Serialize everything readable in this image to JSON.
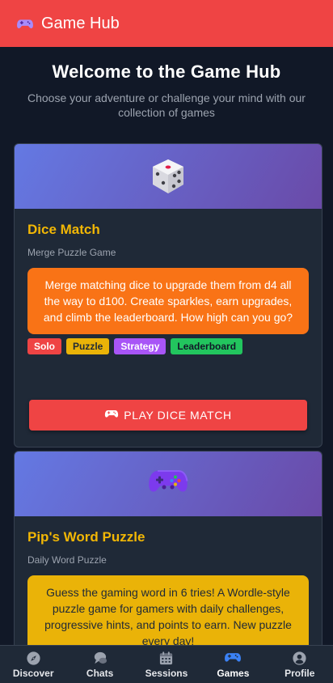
{
  "header": {
    "title": "Game Hub",
    "logo_icon": "gamepad-icon"
  },
  "hero": {
    "title": "Welcome to the Game Hub",
    "subtitle": "Choose your adventure or challenge your mind with our collection of games"
  },
  "games": [
    {
      "title": "Dice Match",
      "subtitle": "Merge Puzzle Game",
      "icon": "dice-icon",
      "description": "Merge matching dice to upgrade them from d4 all the way to d100. Create sparkles, earn upgrades, and climb the leaderboard. How high can you go?",
      "tags": [
        "Solo",
        "Puzzle",
        "Strategy",
        "Leaderboard"
      ],
      "button_label": "PLAY DICE MATCH"
    },
    {
      "title": "Pip's Word Puzzle",
      "subtitle": "Daily Word Puzzle",
      "icon": "gamepad-icon",
      "description": "Guess the gaming word in 6 tries! A Wordle-style puzzle game for gamers with daily challenges, progressive hints, and points to earn. New puzzle every day!"
    }
  ],
  "nav": {
    "items": [
      {
        "label": "Discover",
        "icon": "compass-icon"
      },
      {
        "label": "Chats",
        "icon": "chat-bubbles-icon"
      },
      {
        "label": "Sessions",
        "icon": "calendar-icon"
      },
      {
        "label": "Games",
        "icon": "gamepad-icon",
        "active": true
      },
      {
        "label": "Profile",
        "icon": "user-circle-icon"
      }
    ]
  },
  "colors": {
    "brand_red": "#ef4444",
    "background": "#111827",
    "card": "#1f2937",
    "title_gold": "#f2b705",
    "active_blue": "#3b82f6"
  }
}
